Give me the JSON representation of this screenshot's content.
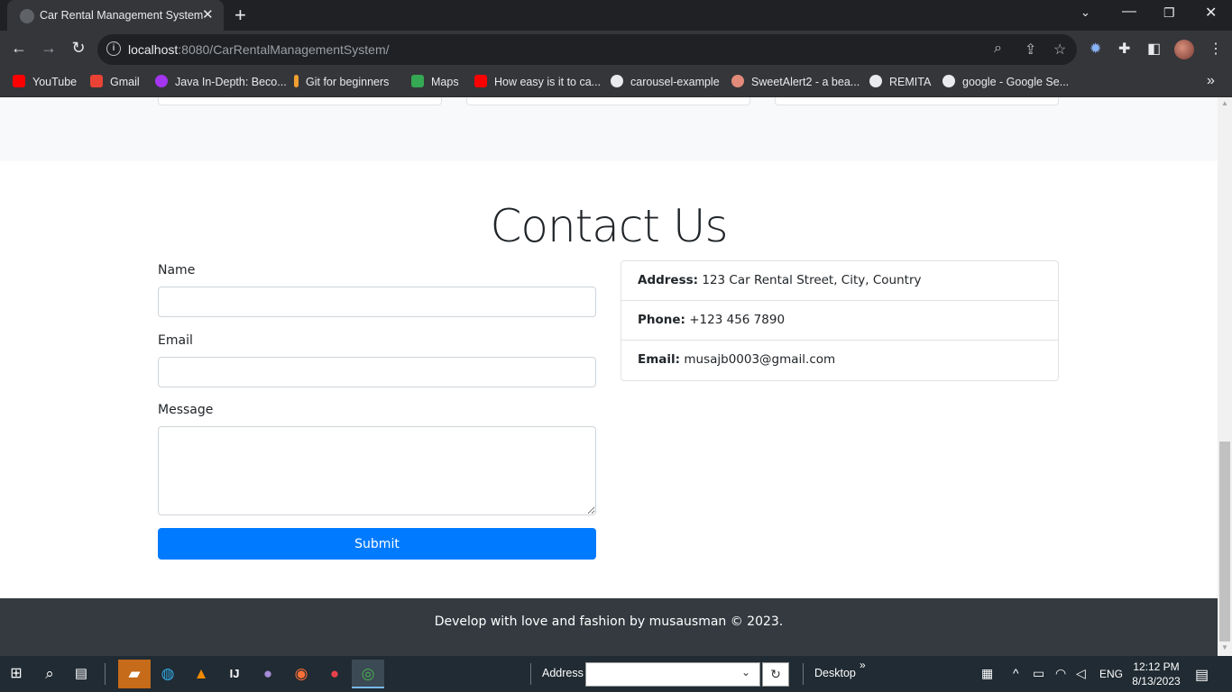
{
  "browser": {
    "tab_title": "Car Rental Management System",
    "url_host": "localhost",
    "url_path": ":8080/CarRentalManagementSystem/",
    "bookmarks": [
      {
        "label": "YouTube",
        "icon": "youtube-icon",
        "color": "#ff0000"
      },
      {
        "label": "Gmail",
        "icon": "gmail-icon",
        "color": "#ea4335"
      },
      {
        "label": "Java In-Depth: Beco...",
        "icon": "udemy-icon",
        "color": "#a435f0"
      },
      {
        "label": "Git for beginners",
        "icon": "git-icon",
        "color": "#f0a030"
      },
      {
        "label": "Maps",
        "icon": "maps-icon",
        "color": "#34a853"
      },
      {
        "label": "How easy is it to ca...",
        "icon": "youtube-icon",
        "color": "#ff0000"
      },
      {
        "label": "carousel-example",
        "icon": "globe-icon",
        "color": "#e8eaed"
      },
      {
        "label": "SweetAlert2 - a bea...",
        "icon": "sweetalert-icon",
        "color": "#e28b7a"
      },
      {
        "label": "REMITA",
        "icon": "globe-icon",
        "color": "#e8eaed"
      },
      {
        "label": "google - Google Se...",
        "icon": "globe-icon",
        "color": "#e8eaed"
      }
    ]
  },
  "page": {
    "contact_heading": "Contact Us",
    "form": {
      "name_label": "Name",
      "name_value": "",
      "email_label": "Email",
      "email_value": "",
      "message_label": "Message",
      "message_value": "",
      "submit_label": "Submit"
    },
    "contact_info": [
      {
        "key": "Address:",
        "value": "123 Car Rental Street, City, Country"
      },
      {
        "key": "Phone:",
        "value": "+123 456 7890"
      },
      {
        "key": "Email:",
        "value": "musajb0003@gmail.com"
      }
    ],
    "footer_text": "Develop with love and fashion by musausman © 2023.",
    "colors": {
      "primary": "#007bff",
      "footer_bg": "#343a40",
      "band_bg": "#f8f9fa"
    }
  },
  "taskbar": {
    "address_label": "Address",
    "desktop_label": "Desktop",
    "language": "ENG",
    "time": "12:12 PM",
    "date": "8/13/2023"
  }
}
